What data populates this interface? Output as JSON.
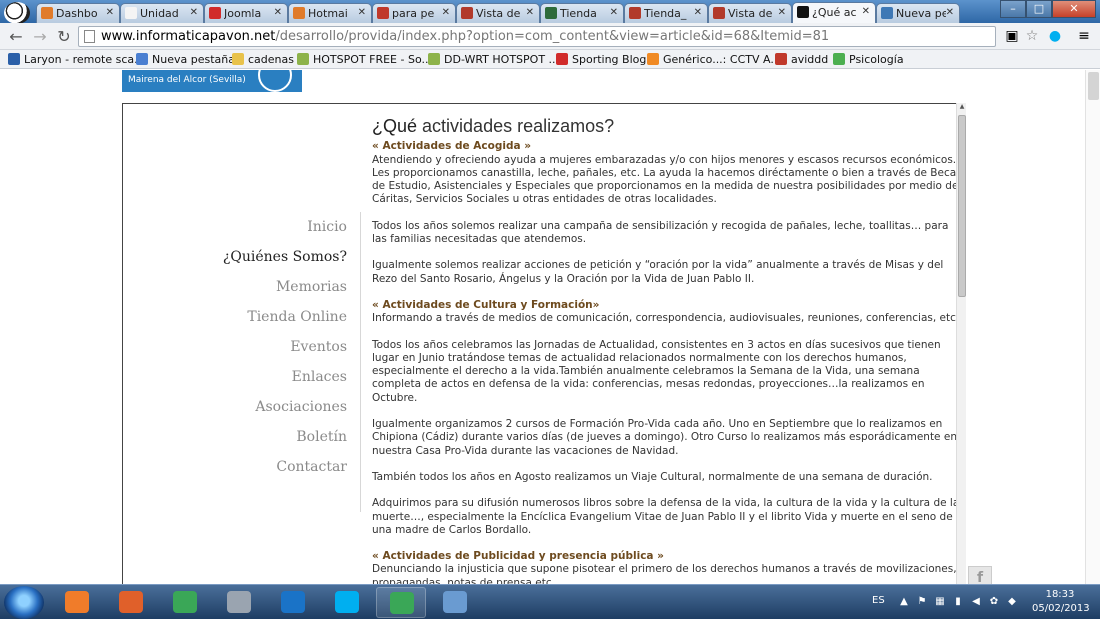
{
  "browser": {
    "tabs": [
      {
        "label": "Dashbo",
        "color": "#e07b2a"
      },
      {
        "label": "Unidad",
        "color": "#f4f4f4"
      },
      {
        "label": "Joomla",
        "color": "#d12b2b"
      },
      {
        "label": "Hotmai",
        "color": "#e07b2a"
      },
      {
        "label": "para pe",
        "color": "#c0392b"
      },
      {
        "label": "Vista de",
        "color": "#b23a2b"
      },
      {
        "label": "Tienda",
        "color": "#2e6b3a"
      },
      {
        "label": "Tienda_",
        "color": "#b23a2b"
      },
      {
        "label": "Vista de",
        "color": "#b23a2b"
      },
      {
        "label": "¿Qué ac",
        "color": "#111111",
        "active": true
      },
      {
        "label": "Nueva pes",
        "color": "#3e78b5",
        "new": true
      }
    ],
    "url_host": "www.informaticapavon.net",
    "url_path": "/desarrollo/provida/index.php?option=com_content&view=article&id=68&Itemid=81",
    "bookmarks": [
      {
        "label": "Laryon - remote sca...",
        "color": "#2a5fa8"
      },
      {
        "label": "Nueva pestaña",
        "color": "#4a7fd1"
      },
      {
        "label": "cadenas",
        "color": "#e8c24a"
      },
      {
        "label": "HOTSPOT FREE - So...",
        "color": "#8db34a"
      },
      {
        "label": "DD-WRT HOTSPOT ...",
        "color": "#8db34a"
      },
      {
        "label": "Sporting Blog",
        "color": "#d12b2b"
      },
      {
        "label": "Genérico...: CCTV A...",
        "color": "#f08a24"
      },
      {
        "label": "aviddd",
        "color": "#c0392b"
      },
      {
        "label": "Psicología",
        "color": "#4caf50"
      }
    ]
  },
  "site": {
    "logo_text": "Mairena del Alcor (Sevilla)",
    "nav": [
      {
        "label": "Inicio"
      },
      {
        "label": "¿Quiénes Somos?",
        "current": true
      },
      {
        "label": "Memorias"
      },
      {
        "label": "Tienda Online"
      },
      {
        "label": "Eventos"
      },
      {
        "label": "Enlaces"
      },
      {
        "label": "Asociaciones"
      },
      {
        "label": "Boletín"
      },
      {
        "label": "Contactar"
      }
    ],
    "article": {
      "title_q": "¿Qué",
      "title_rest": " actividades realizamos?",
      "sections": [
        {
          "heading": "« Actividades de Acogida »",
          "text": "Atendiendo y ofreciendo ayuda a mujeres embarazadas y/o con hijos menores y escasos recursos económicos. Les proporcionamos canastilla, leche, pañales, etc. La ayuda la hacemos diréctamente o bien a través de Becas de Estudio, Asistenciales y Especiales que proporcionamos en la medida de nuestra posibilidades por medio de Cáritas, Servicios Sociales u otras entidades de otras localidades."
        },
        {
          "text": "Todos los años solemos realizar una campaña de sensibilización y recogida de pañales, leche, toallitas… para las familias necesitadas que atendemos."
        },
        {
          "text": "Igualmente solemos realizar acciones de petición y “oración por la vida” anualmente a través de Misas y del Rezo del Santo Rosario, Ángelus y la Oración por la Vida de Juan Pablo II."
        },
        {
          "heading": "« Actividades de Cultura y Formación»",
          "text": "Informando a través de medios de comunicación, correspondencia, audiovisuales, reuniones, conferencias, etc."
        },
        {
          "text": "Todos los años celebramos las Jornadas de Actualidad, consistentes en 3 actos en días sucesivos que tienen lugar en Junio tratándose temas de actualidad relacionados normalmente con los derechos humanos, especialmente el derecho a la vida.También anualmente celebramos la Semana de la Vida, una semana completa de actos en defensa de la vida: conferencias, mesas redondas, proyecciones…la realizamos en Octubre."
        },
        {
          "text": "Igualmente organizamos 2 cursos de Formación Pro-Vida cada año. Uno en Septiembre que lo realizamos en Chipiona (Cádiz) durante varios días (de jueves a domingo). Otro Curso lo realizamos más esporádicamente en nuestra Casa Pro-Vida durante las vacaciones de Navidad."
        },
        {
          "text": "También todos los años en Agosto realizamos un Viaje Cultural, normalmente de una semana de duración."
        },
        {
          "text": "Adquirimos para su difusión numerosos libros sobre la defensa de la vida, la cultura de la vida y la cultura de la muerte…, especialmente la Encíclica Evangelium Vitae de Juan Pablo II y el librito Vida y muerte en el seno de una madre de Carlos Bordallo."
        },
        {
          "heading": "« Actividades de Publicidad y presencia pública »",
          "text": "Denunciando la injusticia que supone pisotear el primero de los derechos humanos a través de movilizaciones, propagandas, notas de prensa etc."
        }
      ]
    },
    "social_tab": "f"
  },
  "taskbar": {
    "apps": [
      {
        "icon": "media-player-icon",
        "color": "#f07c2a"
      },
      {
        "icon": "firefox-icon",
        "color": "#e0602a"
      },
      {
        "icon": "chrome-icon",
        "color": "#3aa757"
      },
      {
        "icon": "app-icon",
        "color": "#9aa4b0"
      },
      {
        "icon": "teamviewer-icon",
        "color": "#1a73c7"
      },
      {
        "icon": "skype-icon",
        "color": "#00aff0"
      },
      {
        "icon": "chrome-icon",
        "color": "#3aa757",
        "active": true
      },
      {
        "icon": "paint-icon",
        "color": "#6a9bd1"
      }
    ],
    "language": "ES",
    "time": "18:33",
    "date": "05/02/2013"
  }
}
